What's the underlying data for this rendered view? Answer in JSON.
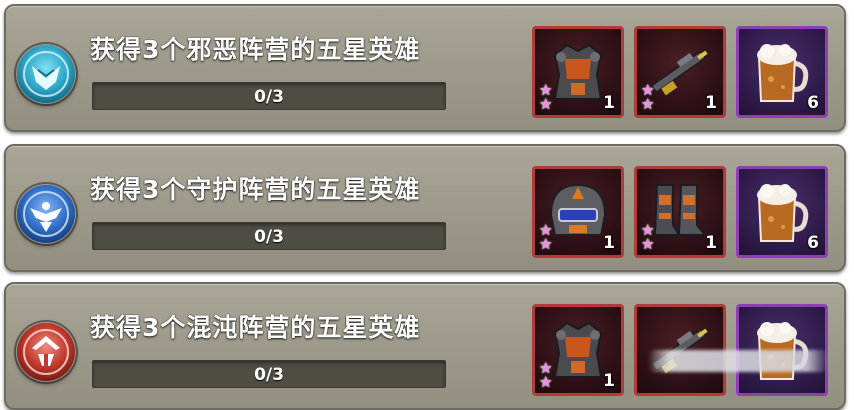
{
  "quests": [
    {
      "title": "获得3个邪恶阵营的五星英雄",
      "faction_icon": "evil-faction-icon",
      "faction_color": "#2fa7c7",
      "progress_text": "0/3",
      "progress": 0,
      "rewards": [
        {
          "item": "armor-chestplate-icon",
          "stars": 2,
          "count": "1",
          "rarity_color": "#b23a3a"
        },
        {
          "item": "rifle-icon",
          "stars": 2,
          "count": "1",
          "rarity_color": "#b23a3a"
        },
        {
          "item": "beer-mug-icon",
          "stars": 0,
          "count": "6",
          "rarity_color": "#8d3fb6"
        }
      ]
    },
    {
      "title": "获得3个守护阵营的五星英雄",
      "faction_icon": "guardian-faction-icon",
      "faction_color": "#2f6fc9",
      "progress_text": "0/3",
      "progress": 0,
      "rewards": [
        {
          "item": "helmet-icon",
          "stars": 2,
          "count": "1",
          "rarity_color": "#b23a3a"
        },
        {
          "item": "boots-icon",
          "stars": 2,
          "count": "1",
          "rarity_color": "#b23a3a"
        },
        {
          "item": "beer-mug-icon",
          "stars": 0,
          "count": "6",
          "rarity_color": "#8d3fb6"
        }
      ]
    },
    {
      "title": "获得3个混沌阵营的五星英雄",
      "faction_icon": "chaos-faction-icon",
      "faction_color": "#c0392b",
      "progress_text": "0/3",
      "progress": 0,
      "rewards": [
        {
          "item": "armor-chestplate-icon",
          "stars": 2,
          "count": "1",
          "rarity_color": "#b23a3a"
        },
        {
          "item": "rifle-icon",
          "stars": 0,
          "count": "",
          "rarity_color": "#b23a3a"
        },
        {
          "item": "beer-mug-icon",
          "stars": 0,
          "count": "",
          "rarity_color": "#8d3fb6"
        }
      ]
    }
  ],
  "star_glyph": "★"
}
